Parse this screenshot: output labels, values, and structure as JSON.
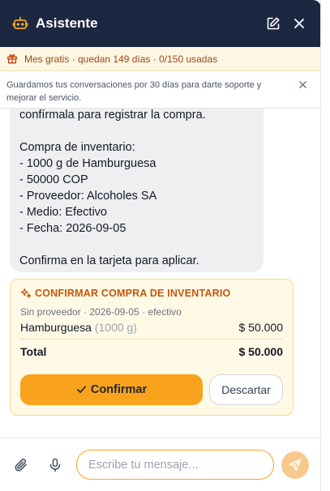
{
  "header": {
    "title": "Asistente",
    "icons": {
      "bot": "robot-icon",
      "edit": "edit-icon",
      "close": "close-icon"
    }
  },
  "trial_banner": {
    "text": "Mes gratis · quedan 149 días · 0/150 usadas",
    "icon": "gift-icon"
  },
  "notice": {
    "text": "Guardamos tus conversaciones por 30 días para darte soporte y mejorar el servicio."
  },
  "assistant_message": {
    "lines": [
      "confírmala para registrar la compra.",
      "",
      "Compra de inventario:",
      "- 1000 g de Hamburguesa",
      "- 50000 COP",
      "- Proveedor: Alcoholes SA",
      "- Medio: Efectivo",
      "- Fecha: 2026-09-05",
      "",
      "Confirma en la tarjeta para aplicar."
    ]
  },
  "confirm_card": {
    "title": "CONFIRMAR COMPRA DE INVENTARIO",
    "meta": "Sin proveedor · 2026-09-05 · efectivo",
    "item_name": "Hamburguesa",
    "item_qty": "(1000 g)",
    "item_amount": "$ 50.000",
    "total_label": "Total",
    "total_amount": "$ 50.000",
    "confirm_label": "Confirmar",
    "discard_label": "Descartar"
  },
  "composer": {
    "placeholder": "Escribe tu mensaje...",
    "value": "",
    "icons": {
      "attach": "paperclip-icon",
      "mic": "microphone-icon",
      "send": "send-icon"
    }
  },
  "colors": {
    "header_bg": "#1c2742",
    "accent": "#f9a21b",
    "trial_bg": "#fdf6e3",
    "trial_text": "#9a4a12",
    "card_bg": "#fff9e6",
    "card_title": "#c2570c",
    "bubble_bg": "#efeff1"
  }
}
